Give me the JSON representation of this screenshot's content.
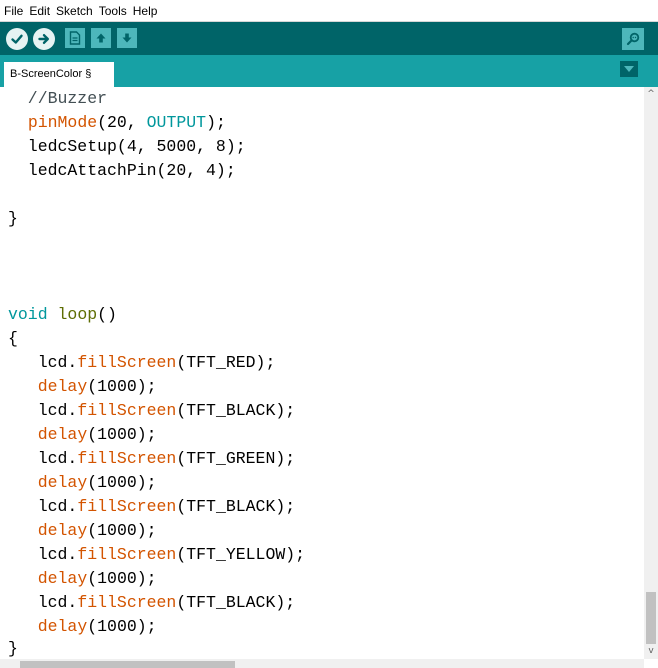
{
  "menu": {
    "file": "File",
    "edit": "Edit",
    "sketch": "Sketch",
    "tools": "Tools",
    "help": "Help"
  },
  "toolbar": {
    "icons": [
      "verify-icon",
      "upload-icon",
      "new-icon",
      "open-icon",
      "save-icon",
      "serial-monitor-icon"
    ]
  },
  "tabs": [
    {
      "label": "B-ScreenColor §"
    }
  ],
  "colors": {
    "toolbar": "#006468",
    "tabstrip": "#17a1a5",
    "keyword_orange": "#d35400",
    "keyword_teal": "#00979c"
  },
  "code": {
    "lines": [
      "  //Buzzer",
      "  pinMode(20, OUTPUT);",
      "  ledcSetup(4, 5000, 8);",
      "  ledcAttachPin(20, 4);",
      "",
      "}",
      "",
      "",
      "",
      "void loop()",
      "{",
      "   lcd.fillScreen(TFT_RED);",
      "   delay(1000);",
      "   lcd.fillScreen(TFT_BLACK);",
      "   delay(1000);",
      "   lcd.fillScreen(TFT_GREEN);",
      "   delay(1000);",
      "   lcd.fillScreen(TFT_BLACK);",
      "   delay(1000);",
      "   lcd.fillScreen(TFT_YELLOW);",
      "   delay(1000);",
      "   lcd.fillScreen(TFT_BLACK);",
      "   delay(1000);",
      "}"
    ]
  }
}
